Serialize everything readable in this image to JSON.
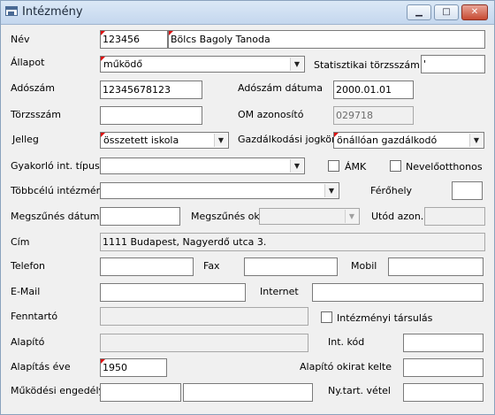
{
  "window": {
    "title": "Intézmény",
    "minimize": "▁",
    "maximize": "□",
    "close": "✕"
  },
  "labels": {
    "nev": "Név",
    "allapot": "Állapot",
    "statisztikai_torzsszam": "Statisztikai törzsszám",
    "adoszam": "Adószám",
    "adoszam_datuma": "Adószám dátuma",
    "torzsszam": "Törzsszám",
    "om_azonosito": "OM azonosító",
    "jelleg": "Jelleg",
    "gazdalkodasi_jogkor": "Gazdálkodási jogkör",
    "gyakorlo_int_tipusa": "Gyakorló int. típusa",
    "amk": "ÁMK",
    "nevelotthonos": "Nevelőotthonos",
    "tobbcelu_intezmeny": "Többcélú intézmény",
    "ferohely": "Férőhely",
    "megszunes_datuma": "Megszűnés dátuma",
    "megszunes_oka": "Megszűnés oka",
    "utod_azon": "Utód azon.",
    "cim": "Cím",
    "telefon": "Telefon",
    "fax": "Fax",
    "mobil": "Mobil",
    "email": "E-Mail",
    "internet": "Internet",
    "fenntarto": "Fenntartó",
    "intezmenyi_tarsulas": "Intézményi társulás",
    "alapito": "Alapító",
    "int_kod": "Int. kód",
    "alapitas_eve": "Alapítás éve",
    "alapito_okirat_kelte": "Alapító okirat kelte",
    "mukodesi_engedely": "Működési engedély",
    "ny_tart_vetel": "Ny.tart. vétel"
  },
  "values": {
    "nev_kod": "123456",
    "nev": "Bölcs Bagoly Tanoda",
    "allapot": "működő",
    "statisztikai_torzsszam": "'",
    "adoszam": "12345678123",
    "adoszam_datuma": "2000.01.01",
    "torzsszam": "",
    "om_azonosito": "029718",
    "jelleg": "összetett iskola",
    "gazdalkodasi_jogkor": "önállóan gazdálkodó",
    "gyakorlo_int_tipusa": "",
    "tobbcelu_intezmeny": "",
    "ferohely": "",
    "megszunes_datuma": "",
    "megszunes_oka": "",
    "utod_azon": "",
    "cim": "1111 Budapest, Nagyerdő utca 3.",
    "telefon": "",
    "fax": "",
    "mobil": "",
    "email": "",
    "internet": "",
    "fenntarto": "",
    "alapito": "",
    "int_kod": "",
    "alapitas_eve": "1950",
    "alapito_okirat_kelte": "",
    "mukodesi_engedely_1": "",
    "mukodesi_engedely_2": "",
    "ny_tart_vetel": ""
  },
  "checkboxes": {
    "amk": false,
    "nevelotthonos": false,
    "intezmenyi_tarsulas": false
  },
  "dropdown_arrow": "▼",
  "icons": {
    "window": "window-icon"
  }
}
